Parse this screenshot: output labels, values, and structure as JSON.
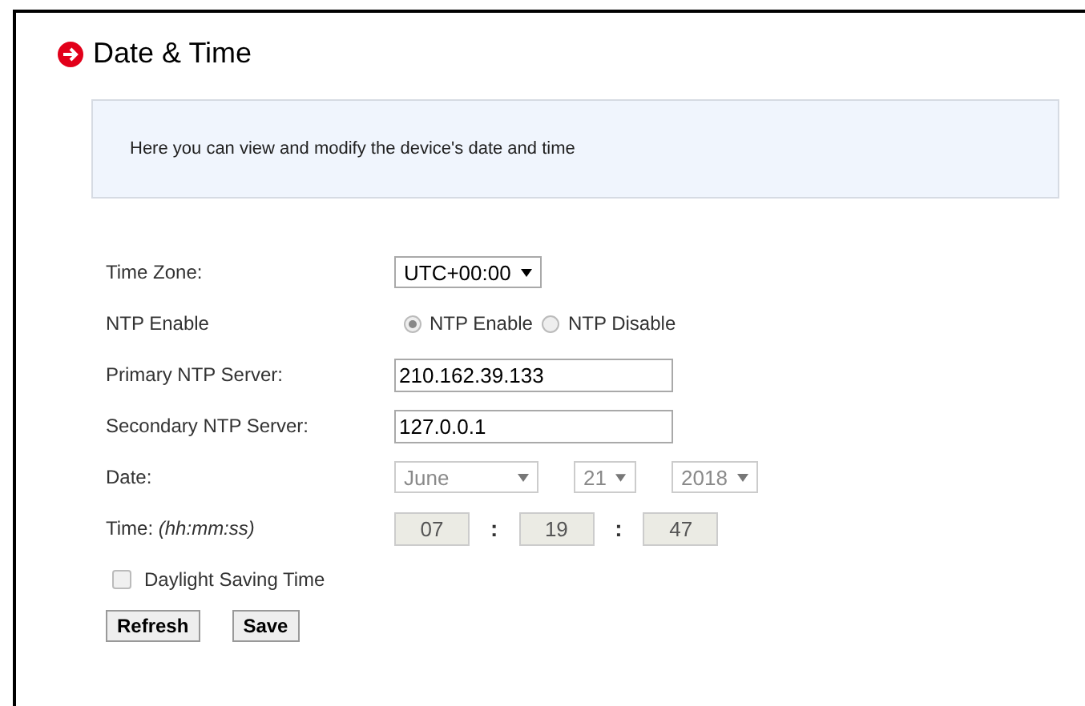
{
  "title": "Date & Time",
  "info": "Here you can view and modify the device's date and time",
  "time_zone": {
    "label": "Time Zone:",
    "value": "UTC+00:00"
  },
  "ntp": {
    "label": "NTP Enable",
    "options": [
      {
        "label": "NTP Enable",
        "selected": true
      },
      {
        "label": "NTP Disable",
        "selected": false
      }
    ]
  },
  "primary_server": {
    "label": "Primary NTP Server:",
    "value": "210.162.39.133"
  },
  "secondary_server": {
    "label": "Secondary NTP Server:",
    "value": "127.0.0.1"
  },
  "date": {
    "label": "Date:",
    "disabled": true,
    "selects": [
      {
        "kind": "month",
        "value": "June"
      },
      {
        "kind": "day",
        "value": "21"
      },
      {
        "kind": "year",
        "value": "2018"
      }
    ]
  },
  "time": {
    "label": "Time:",
    "hint": "(hh:mm:ss)",
    "disabled": true,
    "separator": ":",
    "fields": [
      "07",
      "19",
      "47"
    ]
  },
  "daylight_saving": {
    "label": "Daylight Saving Time",
    "checked": false
  },
  "buttons": [
    "Refresh",
    "Save"
  ]
}
